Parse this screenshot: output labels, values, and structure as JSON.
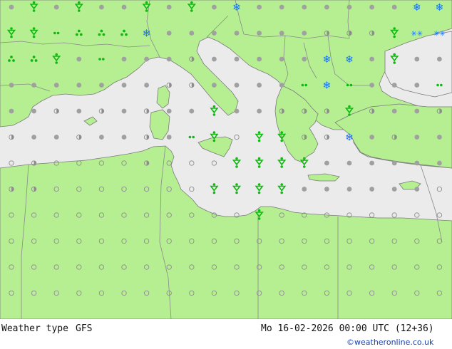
{
  "footer": {
    "product_label": "Weather type",
    "model_label": "GFS",
    "valid_time": "Mo 16-02-2026 00:00 UTC (12+36)",
    "credit": "©weatheronline.co.uk"
  },
  "colors": {
    "land": "#b5ef91",
    "sea": "#ebebeb",
    "border": "#8a8a8a",
    "coast": "#7a7a7a",
    "rain": "#10b810",
    "snow": "#1070ff",
    "cloud": "#a0a0a0"
  },
  "icon_legend": {
    "cloud": "cloud-icon",
    "clear": "clear-sky-icon",
    "partial": "partly-cloudy-icon",
    "rain_shower": "rain-shower-icon",
    "drizzle": "drizzle-icon",
    "rain": "rain-icon",
    "snow": "snow-icon",
    "snow_shower": "snow-shower-icon",
    "sleet": "sleet-icon"
  },
  "grid_rows": [
    "BBBBBBRBRBSBBBBBBBSSWBRB",
    "BRDRRRSBBBBBBBCCCWWWCBBB",
    "RRBBDBBBCBBBBBHSBBBBCBBB",
    "BBBBBBBPCBBBBPSRBBBDBBBB",
    "BBPBPBCBBPBBPCCBPBBCBBBB",
    "PBBPBBPBDBOBBCCSBPBBPPBB",
    "OPOOOOCOOOOOBBBBBBBBBBBB",
    "CPOOOOOOOOBBBBBBBBBOOBOB",
    "OOOOOOOOOOOBOOOOOOOOOOOB",
    "OOOOOOOOOOOOOOOOOOOOOOOO",
    "OOOOOOOOOOOOOOOOOOOOOOOO",
    "OOOOOOOOOOOOOOOOOOOOOOOO"
  ],
  "rain_cells": [
    "r0c1:rain",
    "r0c3:rain",
    "r0c6:rain",
    "r0c8:rain",
    "r0c20:rain",
    "r1c0:rain",
    "r1c1:rain",
    "r1c17:rain",
    "r2c0:shower",
    "r2c1:shower",
    "r2c2:rain",
    "r2c17:rain",
    "r3c13:drizzle",
    "r3c15:drizzle",
    "r4c9:rain",
    "r4c15:rain",
    "r5c9:rain",
    "r5c11:rain",
    "r5c12:rain",
    "r6c10:rain",
    "r6c11:rain",
    "r6c12:rain",
    "r6c13:rain",
    "r7c9:rain",
    "r7c10:rain",
    "r7c11:rain",
    "r7c12:rain",
    "r8c11:rain"
  ]
}
